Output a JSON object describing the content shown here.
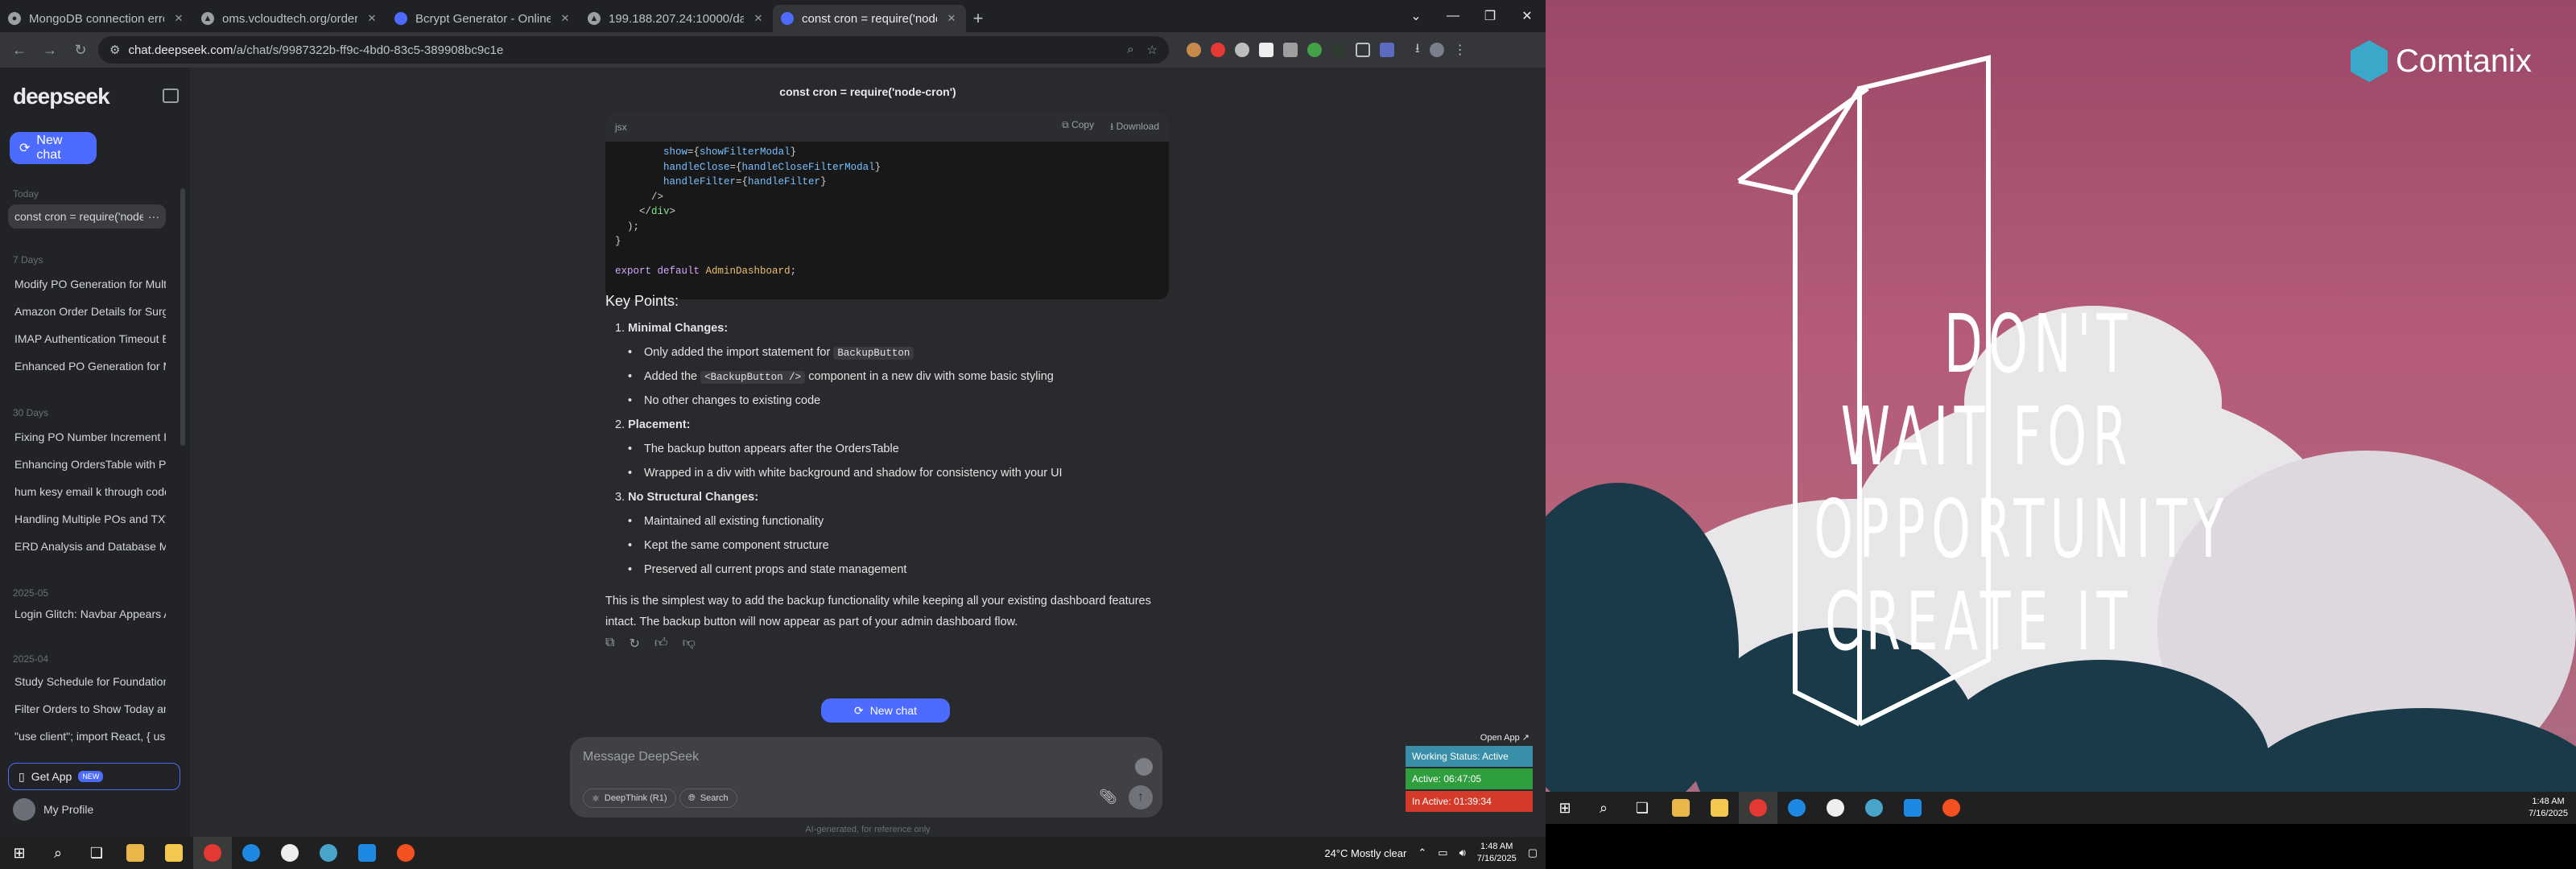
{
  "browser": {
    "tabs": [
      {
        "title": "MongoDB connection error fix",
        "active": false
      },
      {
        "title": "oms.vcloudtech.org/orders/68",
        "active": false
      },
      {
        "title": "Bcrypt Generator - Online Hash",
        "active": false
      },
      {
        "title": "199.188.207.24:10000/dashboard",
        "active": false
      },
      {
        "title": "const cron = require('node-cron",
        "active": true
      }
    ],
    "url_host": "chat.deepseek.com",
    "url_path": "/a/chat/s/9987322b-ff9c-4bd0-83c5-389908bc9c1e"
  },
  "sidebar": {
    "logo": "deepseek",
    "new_chat": "New chat",
    "sections": [
      {
        "label": "Today",
        "items": [
          "const cron = require('node-"
        ]
      },
      {
        "label": "7 Days",
        "items": [
          "Modify PO Generation for Multi",
          "Amazon Order Details for Surge",
          "IMAP Authentication Timeout E",
          "Enhanced PO Generation for Mu"
        ]
      },
      {
        "label": "30 Days",
        "items": [
          "Fixing PO Number Increment Iss",
          "Enhancing OrdersTable with Pro",
          "hum kesy email k through code",
          "Handling Multiple POs and TXW",
          "ERD Analysis and Database Mod"
        ]
      },
      {
        "label": "2025-05",
        "items": [
          "Login Glitch: Navbar Appears Af"
        ]
      },
      {
        "label": "2025-04",
        "items": [
          "Study Schedule for Foundation U",
          "Filter Orders to Show Today and",
          "\"use client\"; import React, { us"
        ]
      }
    ],
    "get_app": "Get App",
    "new_badge": "NEW",
    "profile": "My Profile"
  },
  "chat": {
    "title": "const cron = require('node-cron')",
    "code_lang": "jsx",
    "copy": "Copy",
    "download": "Download",
    "key_points": "Key Points:",
    "points": [
      {
        "num": "1.",
        "heading": "Minimal Changes",
        "bullets": [
          "Only added the import statement for |BackupButton|",
          "Added the |<BackupButton />| component in a new div with some basic styling",
          "No other changes to existing code"
        ]
      },
      {
        "num": "2.",
        "heading": "Placement",
        "bullets": [
          "The backup button appears after the OrdersTable",
          "Wrapped in a div with white background and shadow for consistency with your UI"
        ]
      },
      {
        "num": "3.",
        "heading": "No Structural Changes",
        "bullets": [
          "Maintained all existing functionality",
          "Kept the same component structure",
          "Preserved all current props and state management"
        ]
      }
    ],
    "summary": "This is the simplest way to add the backup functionality while keeping all your existing dashboard features intact. The backup button will now appear as part of your admin dashboard flow.",
    "new_chat_pill": "New chat",
    "placeholder": "Message DeepSeek",
    "deepthink": "DeepThink (R1)",
    "search": "Search",
    "disclaimer": "AI-generated, for reference only"
  },
  "widget": {
    "open_app": "Open App ↗",
    "status": "Working Status: Active",
    "active": "Active: 06:47:05",
    "inactive": "In Active: 01:39:34",
    "colors": {
      "status": "#3a8fa8",
      "active": "#2e9e3e",
      "inactive": "#d43a2a"
    }
  },
  "taskbar_left": {
    "weather": "24°C  Mostly clear",
    "time": "1:48 AM",
    "date": "7/16/2025"
  },
  "wallpaper": {
    "brand": "Comtanix",
    "quote_lines": [
      "DON'T",
      "WAIT FOR",
      "OPPORTUNITY",
      "CREATE IT"
    ]
  },
  "taskbar_right": {
    "time": "1:48 AM",
    "date": "7/16/2025"
  }
}
